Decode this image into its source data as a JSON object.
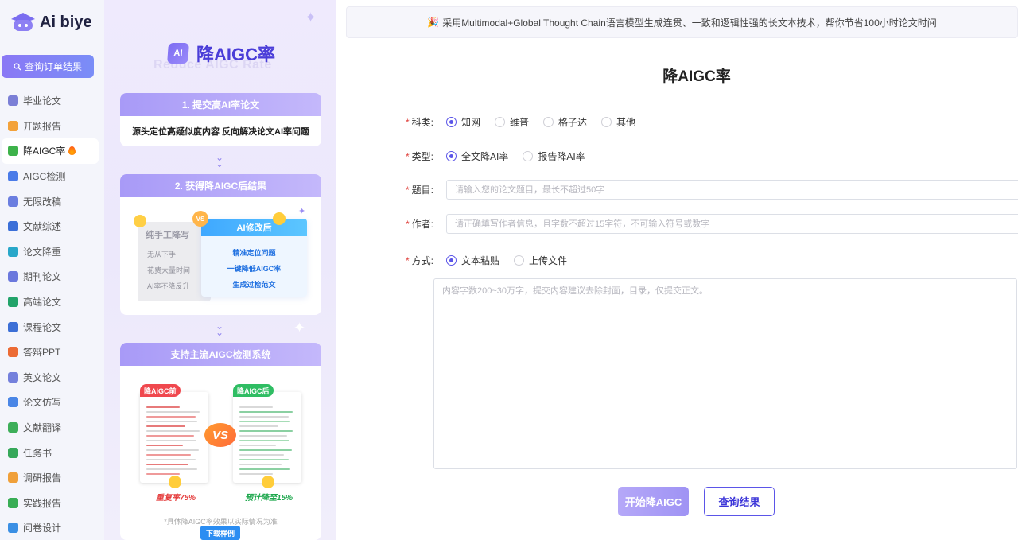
{
  "brand": {
    "logo_text": "Ai biye"
  },
  "sidebar": {
    "query_button": "查询订单结果",
    "items": [
      {
        "label": "毕业论文",
        "icon": "graduation-cap-icon",
        "color": "#7b7fd6"
      },
      {
        "label": "开题报告",
        "icon": "report-icon",
        "color": "#f3a23a"
      },
      {
        "label": "降AIGC率",
        "icon": "ai-badge-icon",
        "color": "#3db24a",
        "active": true
      },
      {
        "label": "AIGC检测",
        "icon": "ai-detect-icon",
        "color": "#4a7be8"
      },
      {
        "label": "无限改稿",
        "icon": "infinite-icon",
        "color": "#6b7ee0"
      },
      {
        "label": "文献综述",
        "icon": "book-icon",
        "color": "#3b6fd8"
      },
      {
        "label": "论文降重",
        "icon": "wave-icon",
        "color": "#28a7c9"
      },
      {
        "label": "期刊论文",
        "icon": "journal-icon",
        "color": "#6b78dd"
      },
      {
        "label": "高端论文",
        "icon": "openai-icon",
        "color": "#22a36a"
      },
      {
        "label": "课程论文",
        "icon": "course-book-icon",
        "color": "#3c6fd6"
      },
      {
        "label": "答辩PPT",
        "icon": "ppt-icon",
        "color": "#ec6b35"
      },
      {
        "label": "英文论文",
        "icon": "english-cap-icon",
        "color": "#7480dc"
      },
      {
        "label": "论文仿写",
        "icon": "copy-write-icon",
        "color": "#4a86e6"
      },
      {
        "label": "文献翻译",
        "icon": "translate-icon",
        "color": "#3dae59"
      },
      {
        "label": "任务书",
        "icon": "task-icon",
        "color": "#36a85a"
      },
      {
        "label": "调研报告",
        "icon": "survey-icon",
        "color": "#f0a03a"
      },
      {
        "label": "实践报告",
        "icon": "practice-icon",
        "color": "#39ad55"
      },
      {
        "label": "问卷设计",
        "icon": "questionnaire-icon",
        "color": "#3a8fe4"
      }
    ]
  },
  "promo": {
    "badge": "AI",
    "title": "降AIGC率",
    "subtitle": "Reduce AIGC Rate",
    "step1": {
      "title": "1. 提交高AI率论文",
      "body": "源头定位高疑似度内容 反向解决论文AI率问题"
    },
    "step2": {
      "title": "2. 获得降AIGC后结果",
      "vs": "VS",
      "manual": {
        "title": "纯手工降写",
        "lines": [
          "无从下手",
          "花费大量时间",
          "AI率不降反升"
        ]
      },
      "ai": {
        "title": "AI修改后",
        "lines": [
          "精准定位问题",
          "一键降低AIGC率",
          "生成过检范文"
        ]
      }
    },
    "step3": {
      "title": "支持主流AIGC检测系统",
      "before_tag": "降AIGC前",
      "after_tag": "降AIGC后",
      "vs": "VS",
      "before_rate": "重复率75%",
      "after_rate": "预计降至15%",
      "note": "*具体降AIGC率效果以实际情况为准",
      "download": "下载样例"
    }
  },
  "main": {
    "banner": "采用Multimodal+Global Thought Chain语言模型生成连贯、一致和逻辑性强的长文本技术，帮你节省100小时论文时间",
    "title": "降AIGC率",
    "subject": {
      "label": "科类:",
      "options": [
        "知网",
        "维普",
        "格子达",
        "其他"
      ],
      "selected": "知网"
    },
    "type": {
      "label": "类型:",
      "options": [
        "全文降AI率",
        "报告降AI率"
      ],
      "selected": "全文降AI率"
    },
    "topic": {
      "label": "题目:",
      "placeholder": "请输入您的论文题目，最长不超过50字",
      "value": ""
    },
    "author": {
      "label": "作者:",
      "placeholder": "请正确填写作者信息，且字数不超过15字符，不可输入符号或数字",
      "value": ""
    },
    "method": {
      "label": "方式:",
      "options": [
        "文本粘贴",
        "上传文件"
      ],
      "selected": "文本粘贴"
    },
    "content": {
      "placeholder": "内容字数200~30万字，提交内容建议去除封面，目录，仅提交正文。",
      "value": ""
    },
    "start_button": "开始降AIGC",
    "query_button": "查询结果"
  },
  "colors": {
    "accent": "#5b55e8",
    "required": "#e0443f",
    "sidebar_bg": "#f4f5fb"
  }
}
